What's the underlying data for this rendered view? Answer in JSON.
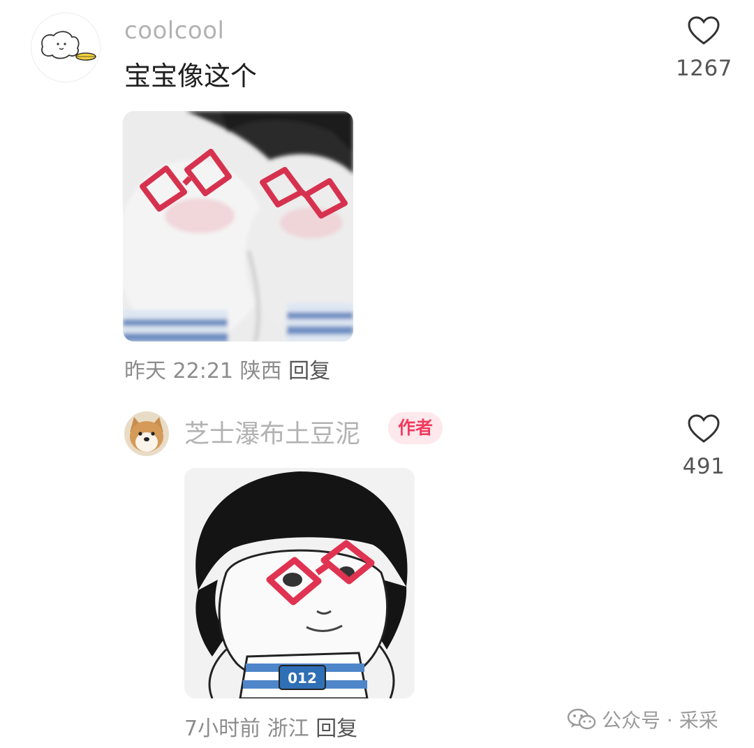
{
  "comments": [
    {
      "username": "coolcool",
      "content": "宝宝像这个",
      "likes": "1267",
      "time": "昨天 22:21",
      "location": "陕西",
      "reply_label": "回复"
    },
    {
      "username": "芝士瀑布土豆泥",
      "author_badge": "作者",
      "likes": "491",
      "time": "7小时前",
      "location": "浙江",
      "reply_label": "回复"
    }
  ],
  "watermark": {
    "text": "公众号 · 采采",
    "icon": "wechat-icon"
  },
  "icons": {
    "like": "heart-outline-icon"
  }
}
